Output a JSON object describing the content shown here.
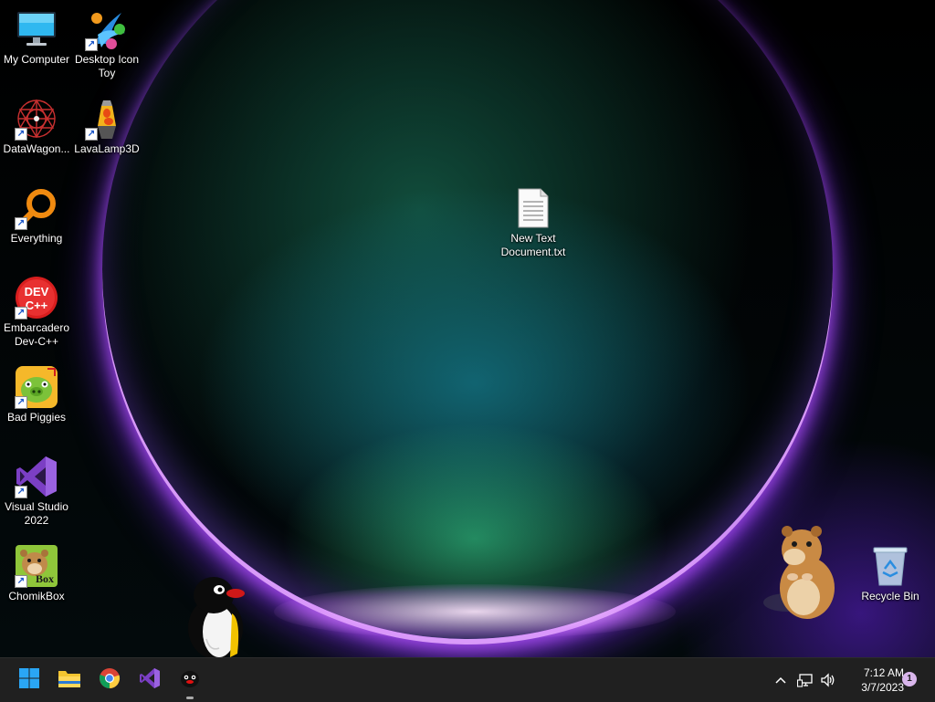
{
  "desktop": {
    "icons": [
      {
        "label": "My Computer",
        "icon": "monitor-icon",
        "shortcut": false
      },
      {
        "label": "Desktop Icon Toy",
        "icon": "desktop-icon-toy-icon",
        "shortcut": true
      },
      {
        "label": "DataWagon...",
        "icon": "datawagon-icon",
        "shortcut": true
      },
      {
        "label": "LavaLamp3D",
        "icon": "lava-lamp-icon",
        "shortcut": true
      },
      {
        "label": "Everything",
        "icon": "magnifier-icon",
        "shortcut": true
      },
      {
        "label": "New Text Document.txt",
        "icon": "text-file-icon",
        "shortcut": false
      },
      {
        "label": "Embarcadero Dev-C++",
        "icon": "devcpp-icon",
        "shortcut": true,
        "glyph": "DEV C++"
      },
      {
        "label": "Bad Piggies",
        "icon": "bad-piggies-icon",
        "shortcut": true
      },
      {
        "label": "Visual Studio 2022",
        "icon": "visual-studio-icon",
        "shortcut": true
      },
      {
        "label": "ChomikBox",
        "icon": "chomikbox-icon",
        "shortcut": true,
        "glyph": "Box"
      },
      {
        "label": "Recycle Bin",
        "icon": "recycle-bin-icon",
        "shortcut": false
      }
    ],
    "overlays": [
      {
        "name": "penguin-mascot"
      },
      {
        "name": "hamster-mascot"
      }
    ]
  },
  "taskbar": {
    "apps": [
      {
        "name": "start-button",
        "icon": "windows-logo-icon"
      },
      {
        "name": "file-explorer",
        "icon": "folder-icon"
      },
      {
        "name": "chrome",
        "icon": "chrome-icon"
      },
      {
        "name": "visual-studio",
        "icon": "visual-studio-icon"
      },
      {
        "name": "penguin-app",
        "icon": "penguin-icon",
        "running": true
      }
    ],
    "tray": {
      "chevron": "chevron-up-icon",
      "network": "network-icon",
      "volume": "volume-icon",
      "time": "7:12 AM",
      "date": "3/7/2023",
      "notification_count": "1"
    }
  },
  "colors": {
    "taskbar_bg": "#202020",
    "accent_purple": "#8a5cf5",
    "start_blue": "#2aa6f5"
  }
}
